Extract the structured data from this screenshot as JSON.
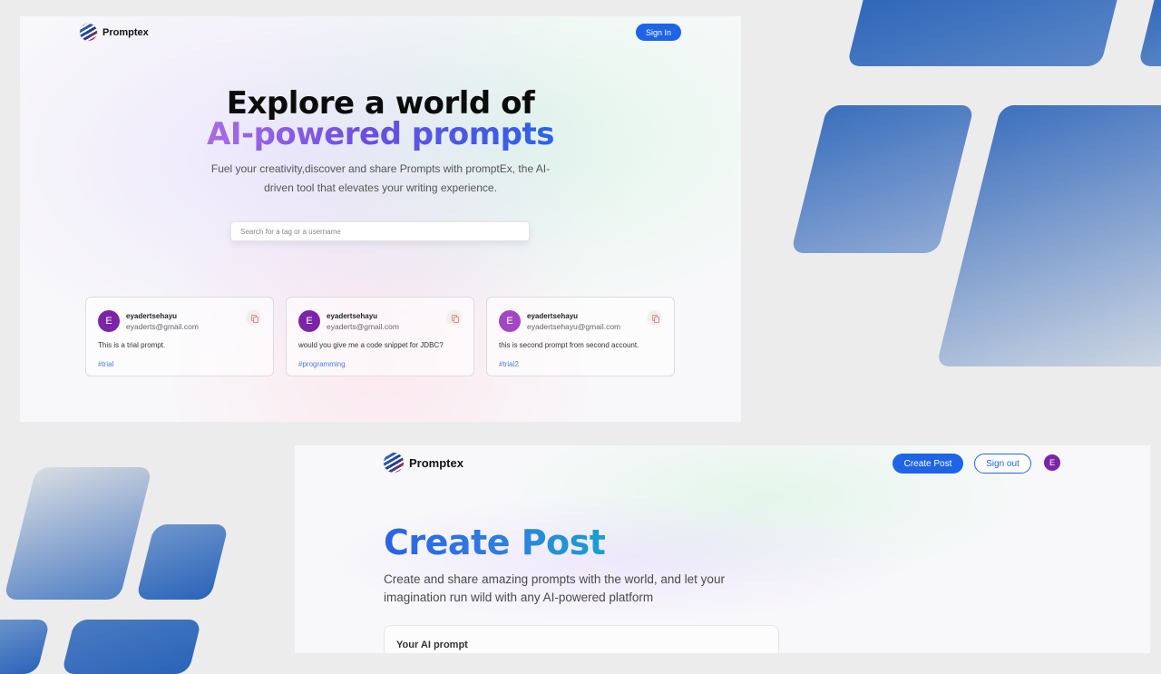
{
  "decor_colors": [
    "#2a64b8",
    "#5b87c7",
    "#cfd7e2"
  ],
  "signin_page": {
    "brand": "Promptex",
    "sign_in_label": "Sign In",
    "headline_line1": "Explore a world of",
    "headline_line2": "AI-powered prompts",
    "subtitle": "Fuel your creativity,discover and share Prompts with promptEx, the AI-driven tool that elevates your writing experience.",
    "search_placeholder": "Search for a tag or a username",
    "cards": [
      {
        "avatar_letter": "E",
        "avatar_color": "#7b24a8",
        "username": "eyadertsehayu",
        "email": "eyaderts@gmail.com",
        "prompt": "This is a trial prompt.",
        "tag": "#trial"
      },
      {
        "avatar_letter": "E",
        "avatar_color": "#7b24a8",
        "username": "eyadertsehayu",
        "email": "eyaderts@gmail.com",
        "prompt": "would you give me a code snippet for JDBC?",
        "tag": "#programming"
      },
      {
        "avatar_letter": "E",
        "avatar_color": "#a247c4",
        "username": "eyadertsehayu",
        "email": "eyadertsehayu@gmail.com",
        "prompt": "this is second prompt from second account.",
        "tag": "#trial2"
      }
    ]
  },
  "create_page": {
    "brand": "Promptex",
    "create_post_label": "Create Post",
    "sign_out_label": "Sign out",
    "avatar_letter": "E",
    "title": "Create Post",
    "subtitle": "Create and share amazing prompts with the world, and let your imagination run wild with any AI-powered platform",
    "prompt_label": "Your AI prompt"
  }
}
